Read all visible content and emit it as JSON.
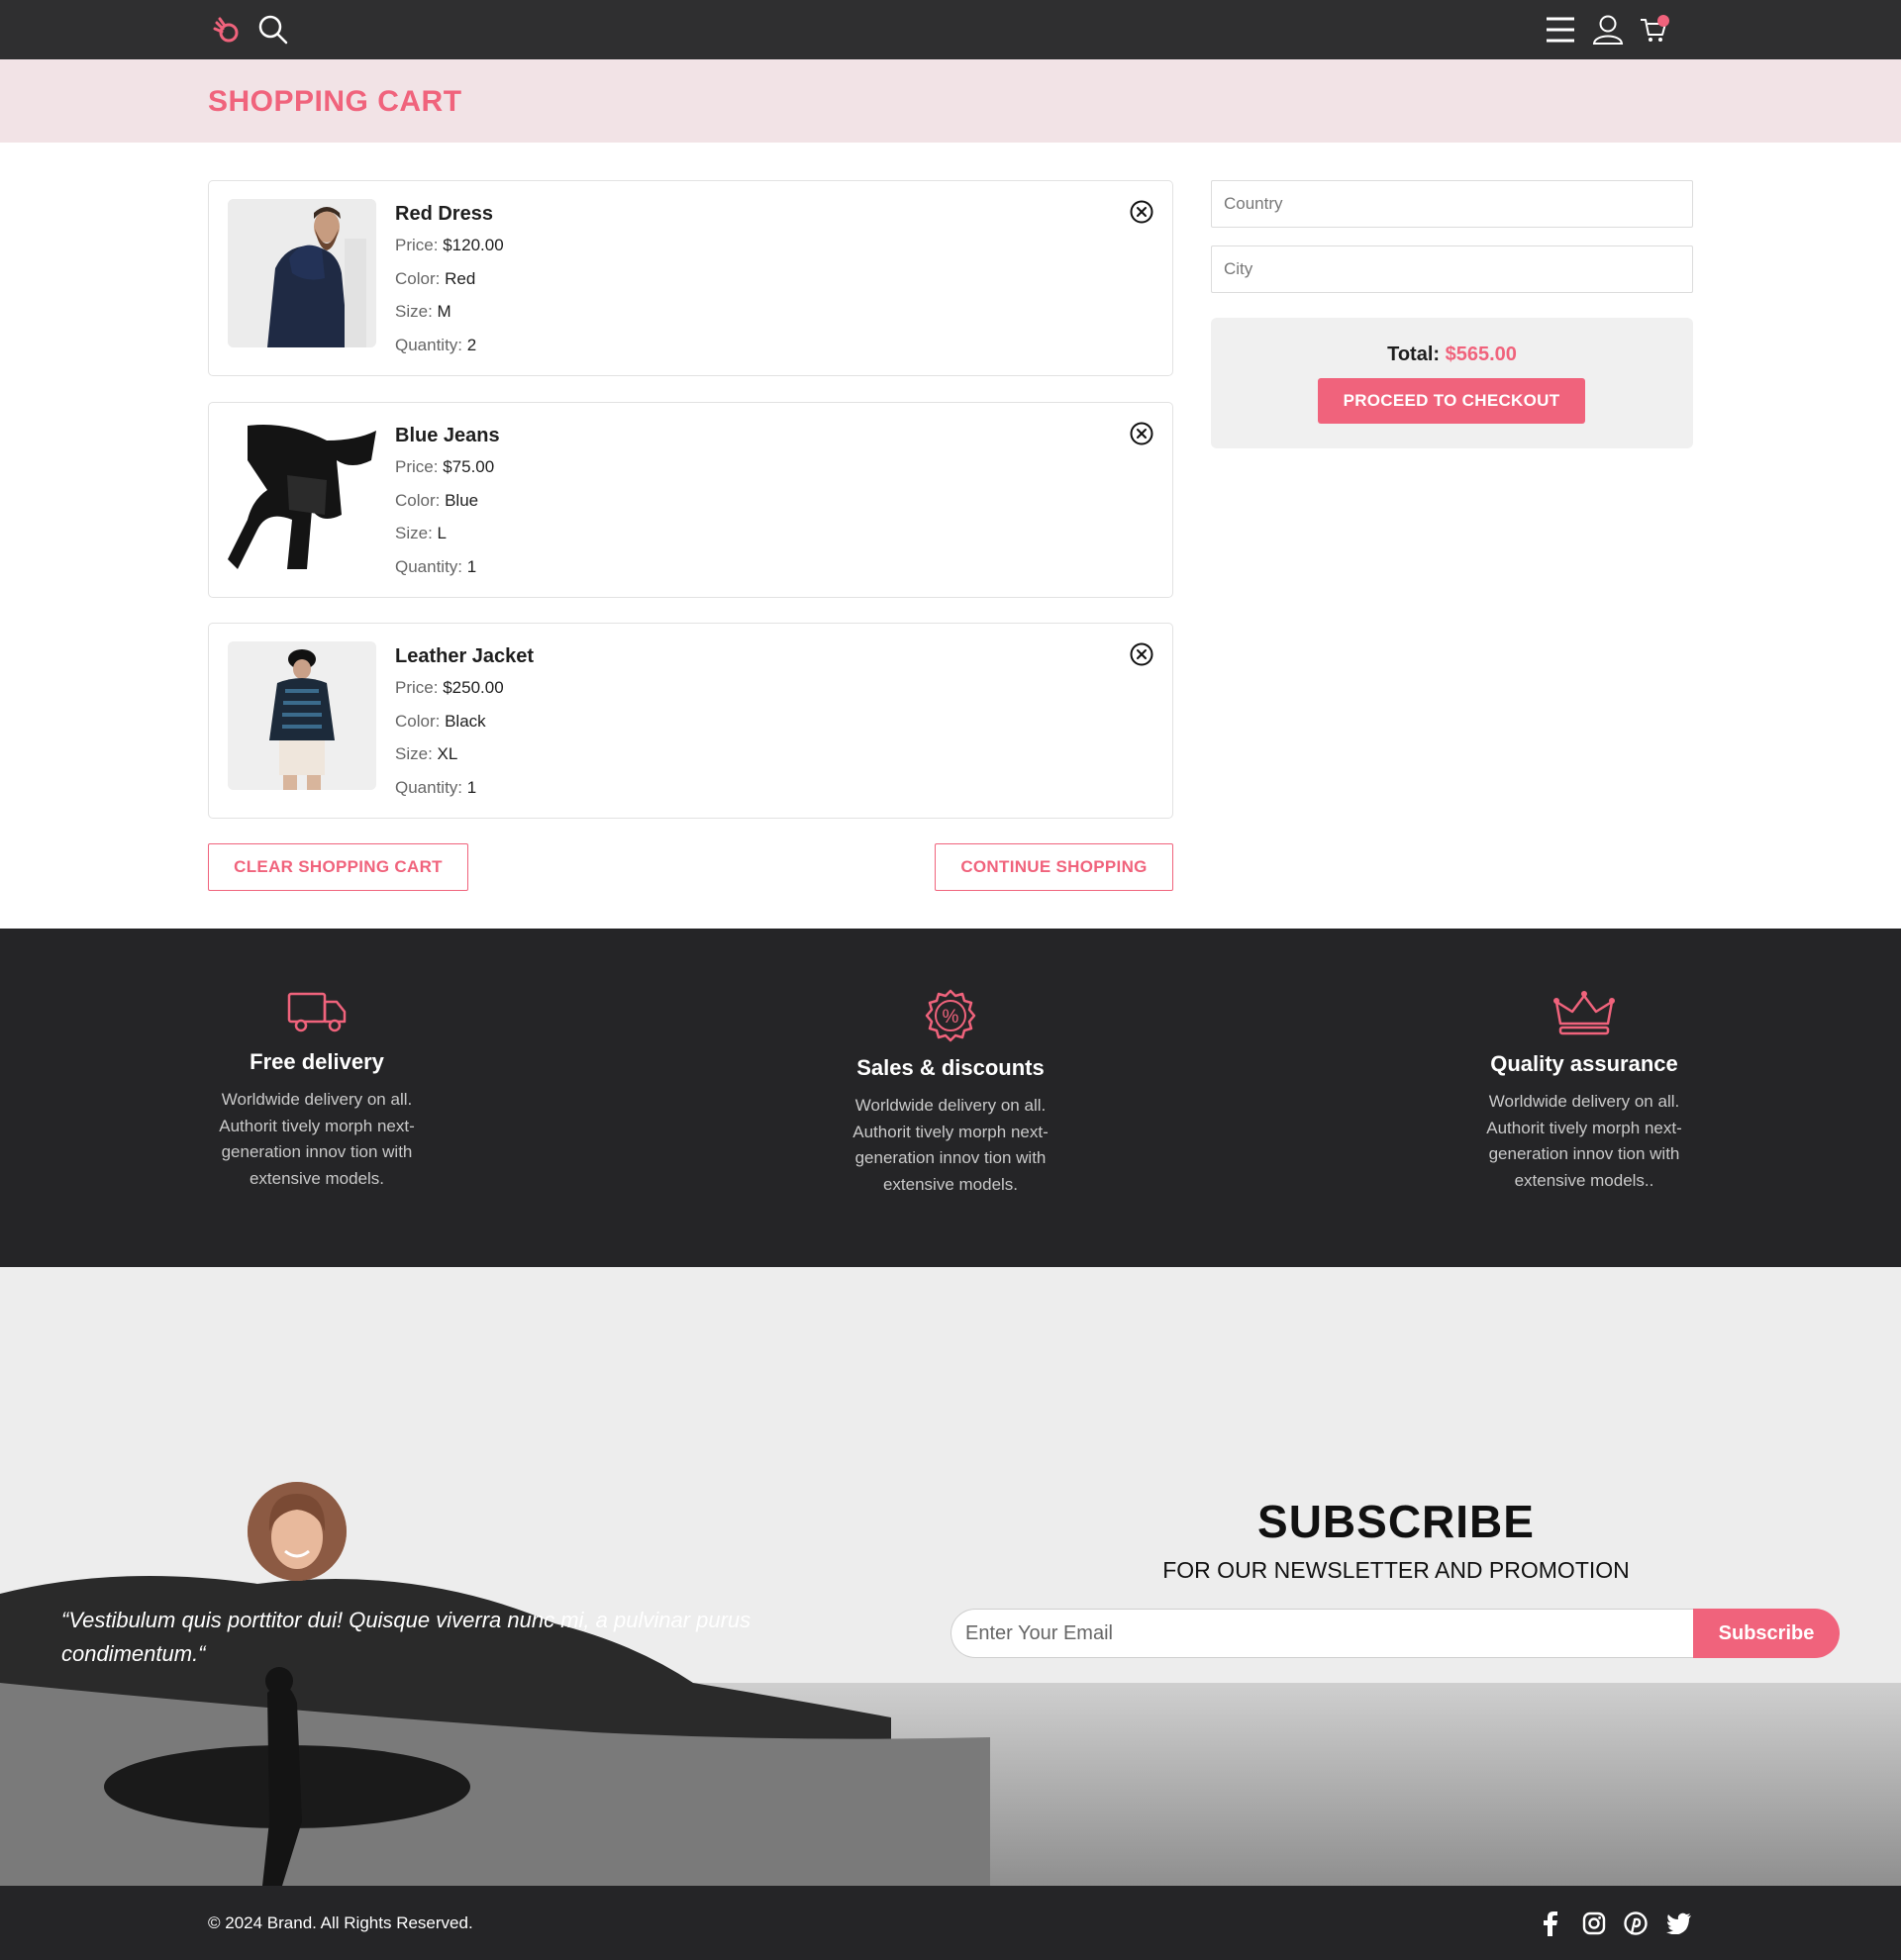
{
  "page": {
    "title": "SHOPPING CART"
  },
  "nav": {
    "icons": [
      "hand-logo-icon",
      "search-icon",
      "menu-icon",
      "user-icon",
      "cart-icon"
    ]
  },
  "cart": {
    "items": [
      {
        "name": "Red Dress",
        "price_label": "Price:",
        "price": "$120.00",
        "color_label": "Color:",
        "color": "Red",
        "size_label": "Size:",
        "size": "M",
        "quantity_label": "Quantity:",
        "quantity": "2"
      },
      {
        "name": "Blue Jeans",
        "price_label": "Price:",
        "price": "$75.00",
        "color_label": "Color:",
        "color": "Blue",
        "size_label": "Size:",
        "size": "L",
        "quantity_label": "Quantity:",
        "quantity": "1"
      },
      {
        "name": "Leather Jacket",
        "price_label": "Price:",
        "price": "$250.00",
        "color_label": "Color:",
        "color": "Black",
        "size_label": "Size:",
        "size": "XL",
        "quantity_label": "Quantity:",
        "quantity": "1"
      }
    ],
    "clear_label": "CLEAR SHOPPING CART",
    "continue_label": "CONTINUE SHOPPING"
  },
  "checkout": {
    "country_placeholder": "Country",
    "city_placeholder": "City",
    "total_label": "Total:",
    "total_value": "$565.00",
    "button_label": "PROCEED TO CHECKOUT"
  },
  "features": [
    {
      "icon": "truck-icon",
      "title": "Free delivery",
      "text": [
        "Worldwide delivery on all.",
        "Authorit tively morph next-",
        "generation innov tion with",
        "extensive models."
      ]
    },
    {
      "icon": "discount-badge-icon",
      "title": "Sales & discounts",
      "text": [
        "Worldwide delivery on all.",
        "Authorit tively morph next-",
        "generation innov tion with",
        "extensive models."
      ]
    },
    {
      "icon": "crown-icon",
      "title": "Quality assurance",
      "text": [
        "Worldwide delivery on all.",
        "Authorit tively morph next-",
        "generation innov tion with",
        "extensive models.."
      ]
    }
  ],
  "subscribe": {
    "quote": "“Vestibulum quis porttitor dui! Quisque viverra nunc mi, a pulvinar purus condimentum.“",
    "title": "SUBSCRIBE",
    "subtitle": "FOR OUR NEWSLETTER AND PROMOTION",
    "email_placeholder": "Enter Your Email",
    "button_label": "Subscribe"
  },
  "footer": {
    "copyright": "© 2024 Brand. All Rights Reserved.",
    "social": [
      "facebook-icon",
      "instagram-icon",
      "pinterest-icon",
      "twitter-icon"
    ]
  },
  "colors": {
    "accent": "#f0637c",
    "dark": "#252527",
    "nav": "#2f2f30",
    "banner": "#f2e3e6"
  }
}
